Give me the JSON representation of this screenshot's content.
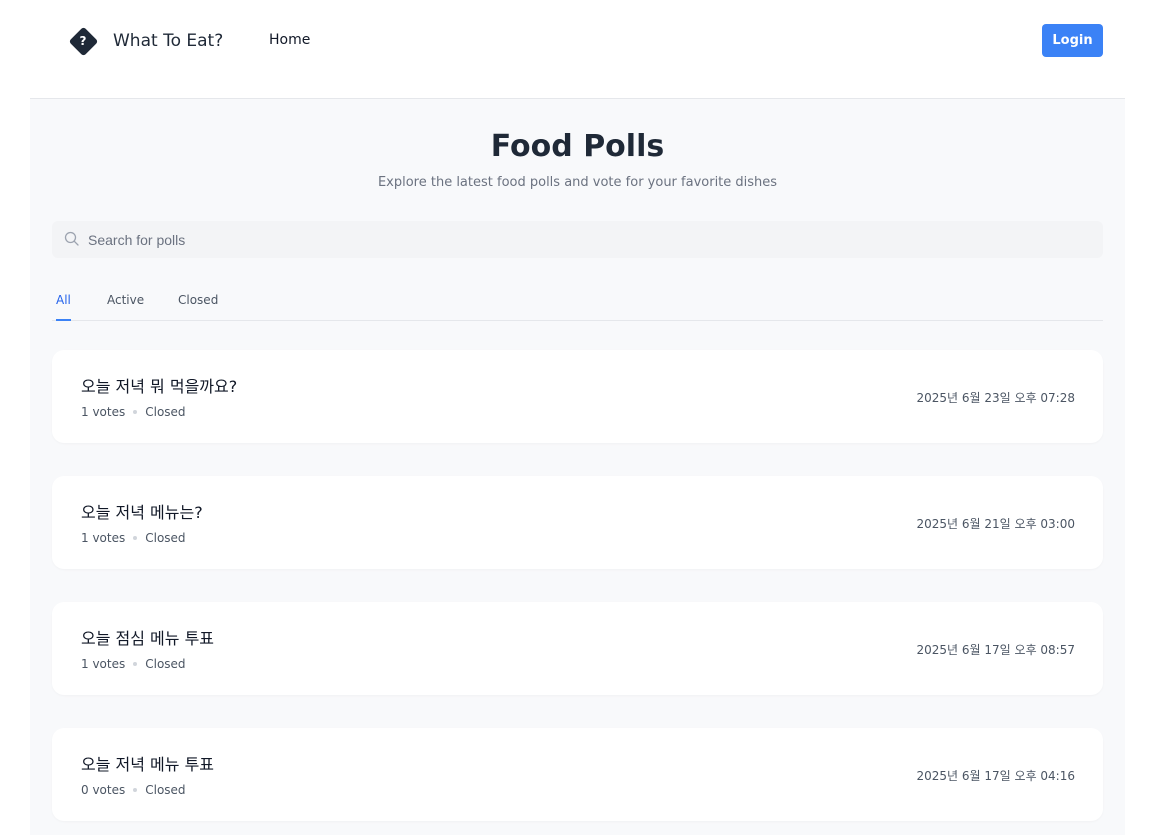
{
  "navbar": {
    "brand_name": "What To Eat?",
    "logo_glyph": "?",
    "home_label": "Home",
    "login_label": "Login"
  },
  "header": {
    "title": "Food Polls",
    "subtitle": "Explore the latest food polls and vote for your favorite dishes"
  },
  "search": {
    "placeholder": "Search for polls",
    "value": ""
  },
  "tabs": [
    {
      "label": "All",
      "active": true
    },
    {
      "label": "Active",
      "active": false
    },
    {
      "label": "Closed",
      "active": false
    }
  ],
  "polls": [
    {
      "title": "오늘 저녁 뭐 먹을까요?",
      "votes": "1 votes",
      "status": "Closed",
      "date": "2025년 6월 23일 오후 07:28"
    },
    {
      "title": "오늘 저녁 메뉴는?",
      "votes": "1 votes",
      "status": "Closed",
      "date": "2025년 6월 21일 오후 03:00"
    },
    {
      "title": "오늘 점심 메뉴 투표",
      "votes": "1 votes",
      "status": "Closed",
      "date": "2025년 6월 17일 오후 08:57"
    },
    {
      "title": "오늘 저녁 메뉴 투표",
      "votes": "0 votes",
      "status": "Closed",
      "date": "2025년 6월 17일 오후 04:16"
    }
  ],
  "colors": {
    "accent": "#3b82f6",
    "background": "#f8f9fb",
    "text": "#1f2937"
  }
}
